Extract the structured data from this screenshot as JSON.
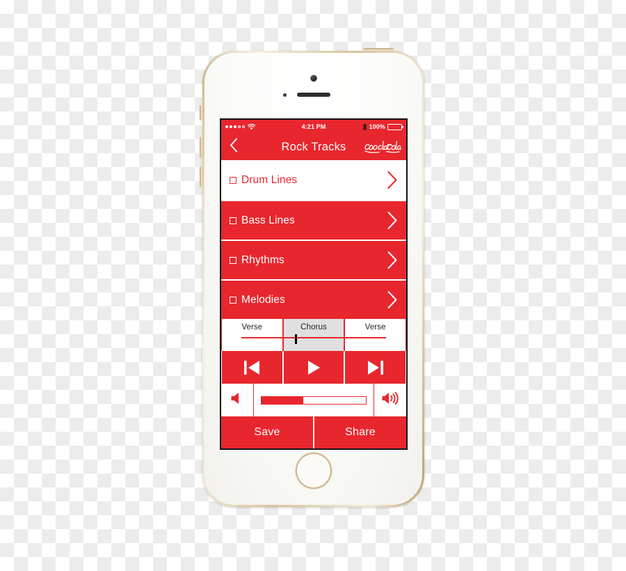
{
  "device": {
    "name": "iphone-5s-gold",
    "bezel_color": "#d8c49a",
    "face_color": "#fbfaf7"
  },
  "theme": {
    "brand_red": "#e8262d",
    "white": "#ffffff",
    "segment_active_gray": "#e0e0e0",
    "playhead_black": "#000000"
  },
  "status_bar": {
    "signal_dots_filled": 3,
    "signal_dots_total": 5,
    "wifi_icon": "wifi-icon",
    "time": "4:21 PM",
    "bluetooth_icon": "bluetooth-icon",
    "battery_percent": "100%",
    "battery_level": 100
  },
  "nav": {
    "back_icon": "chevron-left-icon",
    "title": "Rock Tracks",
    "logo": "coca-cola-logo"
  },
  "tracks": [
    {
      "label": "Drum Lines",
      "style": "light",
      "checkbox": "checkbox-unchecked",
      "chevron": "chevron-right-icon"
    },
    {
      "label": "Bass Lines",
      "style": "dark",
      "checkbox": "checkbox-unchecked",
      "chevron": "chevron-right-icon"
    },
    {
      "label": "Rhythms",
      "style": "dark",
      "checkbox": "checkbox-unchecked",
      "chevron": "chevron-right-icon"
    },
    {
      "label": "Melodies",
      "style": "dark",
      "checkbox": "checkbox-unchecked",
      "chevron": "chevron-right-icon"
    }
  ],
  "timeline": {
    "segments": [
      {
        "label": "Verse",
        "active": false
      },
      {
        "label": "Chorus",
        "active": true
      },
      {
        "label": "Verse",
        "active": false
      }
    ],
    "playhead_position_percent": 40
  },
  "transport": {
    "previous_icon": "skip-previous-icon",
    "play_icon": "play-icon",
    "next_icon": "skip-next-icon"
  },
  "volume": {
    "mute_icon": "volume-low-icon",
    "loud_icon": "volume-high-icon",
    "level_percent": 40
  },
  "actions": {
    "save_label": "Save",
    "share_label": "Share"
  }
}
